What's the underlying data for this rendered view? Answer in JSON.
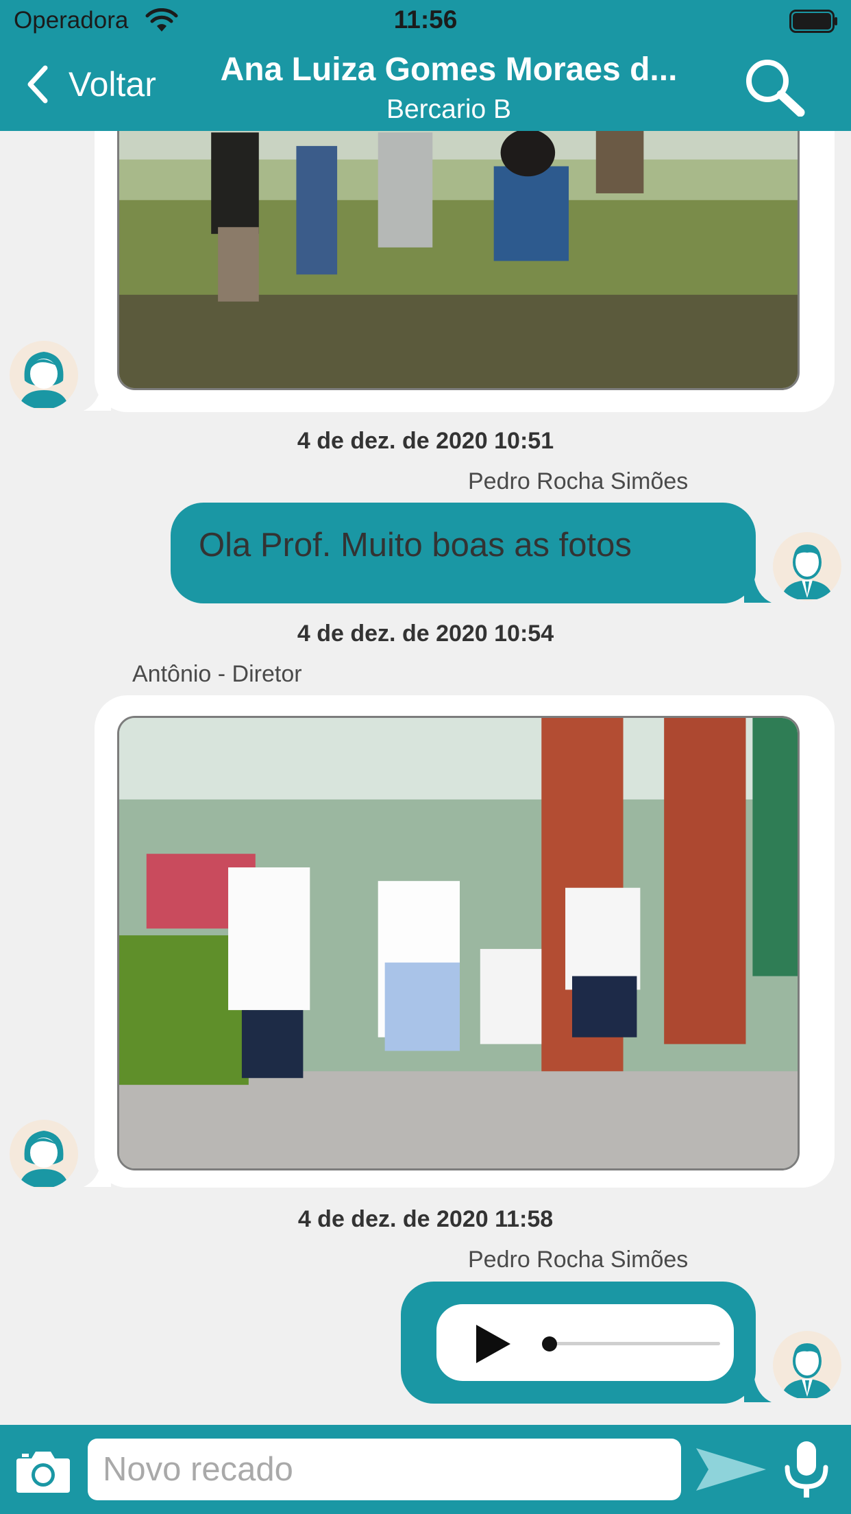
{
  "status_bar": {
    "carrier": "Operadora",
    "time": "11:56"
  },
  "nav": {
    "back_label": "Voltar",
    "title": "Ana Luiza Gomes Moraes d...",
    "subtitle": "Bercario B"
  },
  "messages": [
    {
      "type": "image",
      "direction": "incoming",
      "image_desc_icon": "children-playing-photo"
    },
    {
      "type": "text",
      "direction": "outgoing",
      "timestamp": "4 de dez. de 2020 10:51",
      "sender": "Pedro Rocha Simões",
      "text": "Ola Prof. Muito boas as fotos"
    },
    {
      "type": "image",
      "direction": "incoming",
      "timestamp": "4 de dez. de 2020 10:54",
      "sender": "Antônio - Diretor",
      "image_desc_icon": "children-running-photo"
    },
    {
      "type": "audio",
      "direction": "outgoing",
      "timestamp": "4 de dez. de 2020 11:58",
      "sender": "Pedro Rocha Simões"
    }
  ],
  "input": {
    "placeholder": "Novo recado"
  },
  "colors": {
    "accent": "#1a97a4",
    "background": "#f0f0f0",
    "bubble_in": "#ffffff"
  }
}
